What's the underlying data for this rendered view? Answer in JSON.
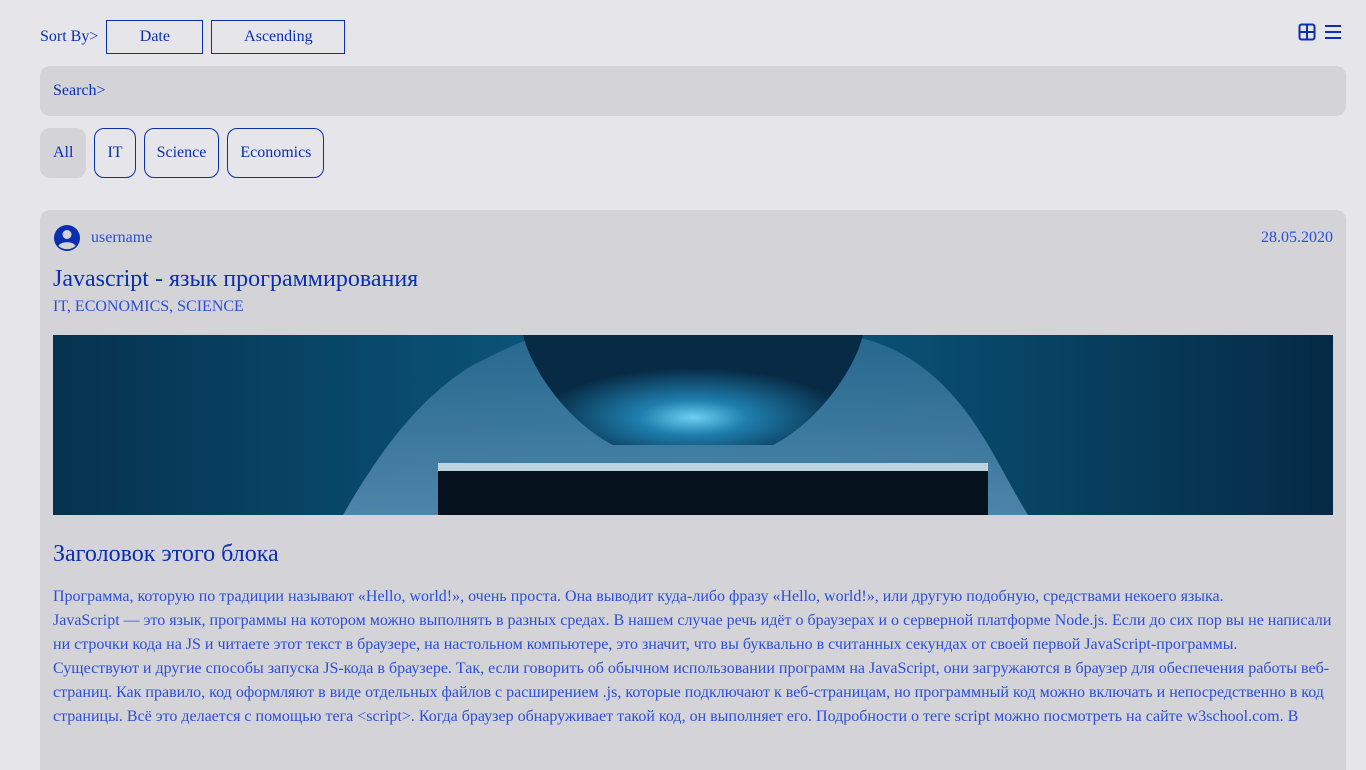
{
  "sort": {
    "label": "Sort By>",
    "field": "Date",
    "order": "Ascending"
  },
  "view_toggle": {
    "grid_icon": "grid-icon",
    "list_icon": "list-icon"
  },
  "search": {
    "label": "Search>",
    "value": ""
  },
  "filters": [
    {
      "label": "All",
      "active": true
    },
    {
      "label": "IT",
      "active": false
    },
    {
      "label": "Science",
      "active": false
    },
    {
      "label": "Economics",
      "active": false
    }
  ],
  "post": {
    "username": "username",
    "date": "28.05.2020",
    "title": "Javascript - язык программирования",
    "tags": "IT, ECONOMICS, SCIENCE",
    "block_title": "Заголовок этого блока",
    "paragraphs": [
      "Программа, которую по традиции называют «Hello, world!», очень проста. Она выводит куда-либо фразу «Hello, world!», или другую подобную, средствами некоего языка.",
      "JavaScript — это язык, программы на котором можно выполнять в разных средах. В нашем случае речь идёт о браузерах и о серверной платформе Node.js. Если до сих пор вы не написали ни строчки кода на JS и читаете этот текст в браузере, на настольном компьютере, это значит, что вы буквально в считанных секундах от своей первой JavaScript-программы.",
      "Существуют и другие способы запуска JS-кода в браузере. Так, если говорить об обычном использовании программ на JavaScript, они загружаются в браузер для обеспечения работы веб-страниц. Как правило, код оформляют в виде отдельных файлов с расширением .js, которые подключают к веб-страницам, но программный код можно включать и непосредственно в код страницы. Всё это делается с помощью тега <script>. Когда браузер обнаруживает такой код, он выполняет его. Подробности о теге script можно посмотреть на сайте w3school.com. В"
    ]
  },
  "colors": {
    "background": "#e6e6ea",
    "panel": "#d4d4d8",
    "accent": "#0a2fb0",
    "text_link": "#2a4fd6"
  }
}
